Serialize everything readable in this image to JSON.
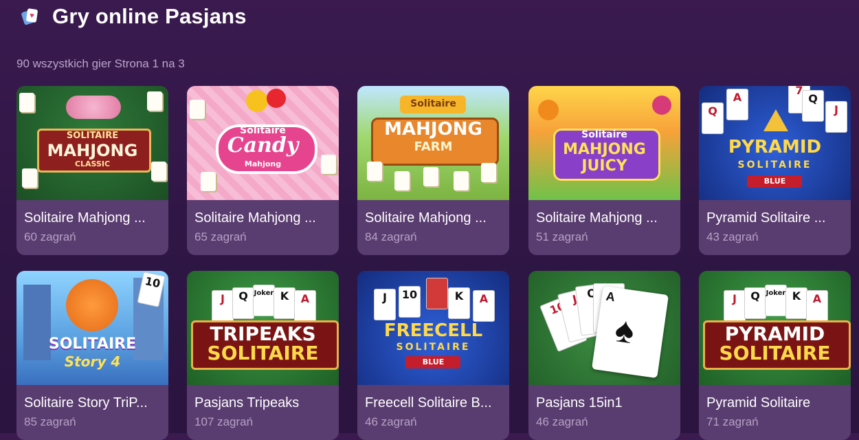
{
  "header": {
    "title": "Gry online Pasjans",
    "icon": "playing-cards-icon",
    "summary": "90 wszystkich gier Strona 1 na 3"
  },
  "games": [
    {
      "title": "Solitaire Mahjong ...",
      "plays": "60 zagrań",
      "logo": [
        "SOLITAIRE",
        "MAHJONG",
        "CLASSIC"
      ]
    },
    {
      "title": "Solitaire Mahjong ...",
      "plays": "65 zagrań",
      "logo": [
        "Solitaire",
        "Candy",
        "Mahjong"
      ]
    },
    {
      "title": "Solitaire Mahjong ...",
      "plays": "84 zagrań",
      "logo": [
        "Solitaire",
        "MAHJONG",
        "FARM"
      ]
    },
    {
      "title": "Solitaire Mahjong ...",
      "plays": "51 zagrań",
      "logo": [
        "Solitaire",
        "MAHJONG",
        "JUICY"
      ]
    },
    {
      "title": "Pyramid Solitaire ...",
      "plays": "43 zagrań",
      "logo": [
        "PYRAMID",
        "SOLITAIRE",
        "BLUE"
      ]
    },
    {
      "title": "Solitaire Story TriP...",
      "plays": "85 zagrań",
      "logo": [
        "SOLITAIRE",
        "Story 4"
      ]
    },
    {
      "title": "Pasjans Tripeaks",
      "plays": "107 zagrań",
      "logo": [
        "TRIPEAKS",
        "SOLITAIRE"
      ]
    },
    {
      "title": "Freecell Solitaire B...",
      "plays": "46 zagrań",
      "logo": [
        "FREECELL",
        "SOLITAIRE",
        "BLUE"
      ]
    },
    {
      "title": "Pasjans 15in1",
      "plays": "46 zagrań",
      "logo": []
    },
    {
      "title": "Pyramid Solitaire",
      "plays": "71 zagrań",
      "logo": [
        "PYRAMID",
        "SOLITAIRE"
      ]
    }
  ],
  "card_labels": {
    "joker": "Joker",
    "q": "Q",
    "j": "J",
    "k": "K",
    "a": "A",
    "ten": "10",
    "seven": "7"
  }
}
